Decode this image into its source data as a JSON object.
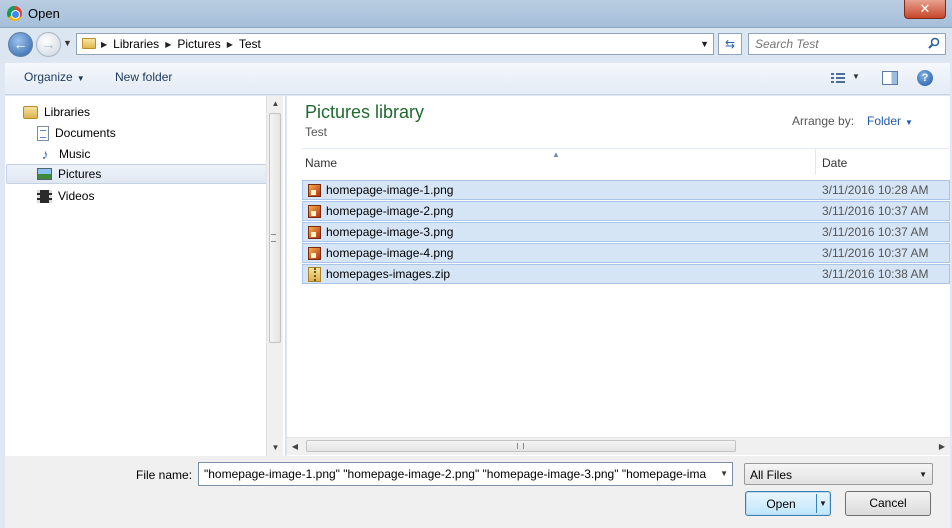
{
  "window": {
    "title": "Open",
    "close_symbol": "✕"
  },
  "address": {
    "crumbs": [
      "Libraries",
      "Pictures",
      "Test"
    ],
    "search_placeholder": "Search Test"
  },
  "toolbar": {
    "organize_label": "Organize",
    "new_folder_label": "New folder"
  },
  "nav_pane": {
    "items": [
      {
        "label": "Libraries",
        "icon": "libraries-icon"
      },
      {
        "label": "Documents",
        "icon": "documents-icon"
      },
      {
        "label": "Music",
        "icon": "music-icon"
      },
      {
        "label": "Pictures",
        "icon": "pictures-icon",
        "selected": true
      },
      {
        "label": "Videos",
        "icon": "videos-icon"
      }
    ]
  },
  "content": {
    "library_title": "Pictures library",
    "library_subtitle": "Test",
    "arrange_label": "Arrange by:",
    "arrange_value": "Folder",
    "columns": {
      "name": "Name",
      "date": "Date"
    },
    "files": [
      {
        "name": "homepage-image-1.png",
        "date": "3/11/2016 10:28 AM",
        "type": "png",
        "selected": true
      },
      {
        "name": "homepage-image-2.png",
        "date": "3/11/2016 10:37 AM",
        "type": "png",
        "selected": true
      },
      {
        "name": "homepage-image-3.png",
        "date": "3/11/2016 10:37 AM",
        "type": "png",
        "selected": true
      },
      {
        "name": "homepage-image-4.png",
        "date": "3/11/2016 10:37 AM",
        "type": "png",
        "selected": true
      },
      {
        "name": "homepages-images.zip",
        "date": "3/11/2016 10:38 AM",
        "type": "zip",
        "selected": true
      }
    ]
  },
  "footer": {
    "file_name_label": "File name:",
    "file_name_value": "\"homepage-image-1.png\" \"homepage-image-2.png\" \"homepage-image-3.png\" \"homepage-ima",
    "file_type_value": "All Files",
    "open_label": "Open",
    "cancel_label": "Cancel"
  }
}
